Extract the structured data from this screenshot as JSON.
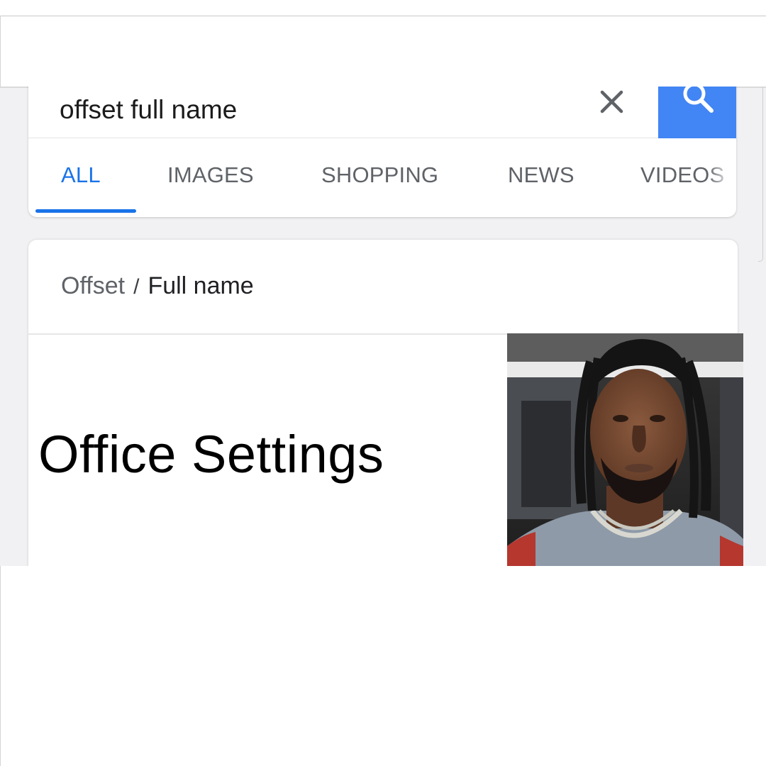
{
  "search": {
    "query": "offset full name"
  },
  "tabs": [
    {
      "label": "ALL",
      "active": true
    },
    {
      "label": "IMAGES",
      "active": false
    },
    {
      "label": "SHOPPING",
      "active": false
    },
    {
      "label": "NEWS",
      "active": false
    },
    {
      "label": "VIDEOS",
      "active": false
    }
  ],
  "breadcrumb": {
    "parent": "Offset",
    "separator": "/",
    "current": "Full name"
  },
  "answer": {
    "text": "Office Settings"
  },
  "icons": {
    "clear": "close-icon",
    "search": "search-icon"
  },
  "colors": {
    "accent": "#4285f4",
    "active_tab": "#1a73e8",
    "tab_text": "#5f6368"
  }
}
